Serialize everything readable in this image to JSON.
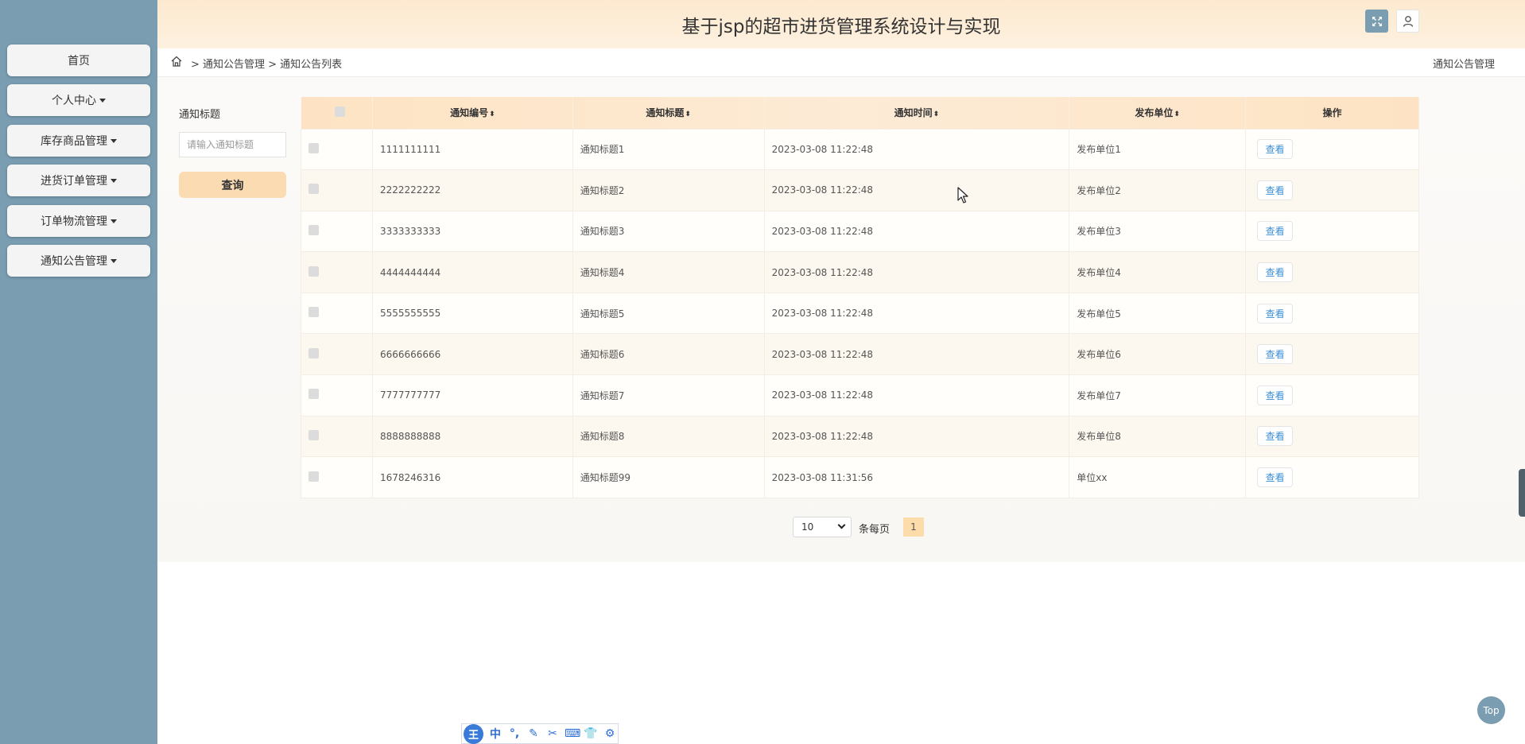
{
  "sidebar": {
    "items": [
      {
        "label": "首页",
        "dropdown": false
      },
      {
        "label": "个人中心",
        "dropdown": true
      },
      {
        "label": "库存商品管理",
        "dropdown": true
      },
      {
        "label": "进货订单管理",
        "dropdown": true
      },
      {
        "label": "订单物流管理",
        "dropdown": true
      },
      {
        "label": "通知公告管理",
        "dropdown": true
      }
    ]
  },
  "header": {
    "title": "基于jsp的超市进货管理系统设计与实现",
    "expand_icon": "fullscreen-icon",
    "user_icon": "user-icon"
  },
  "breadcrumb": {
    "home_icon": "home-icon",
    "path": "> 通知公告管理 > 通知公告列表",
    "current": "通知公告管理"
  },
  "search": {
    "label": "通知标题",
    "placeholder": "请输入通知标题",
    "button": "查询"
  },
  "table": {
    "columns": [
      "通知编号",
      "通知标题",
      "通知时间",
      "发布单位",
      "操作"
    ],
    "sort_marker": "⬍",
    "action_label": "查看",
    "rows": [
      {
        "id": "1111111111",
        "title": "通知标题1",
        "time": "2023-03-08 11:22:48",
        "unit": "发布单位1"
      },
      {
        "id": "2222222222",
        "title": "通知标题2",
        "time": "2023-03-08 11:22:48",
        "unit": "发布单位2"
      },
      {
        "id": "3333333333",
        "title": "通知标题3",
        "time": "2023-03-08 11:22:48",
        "unit": "发布单位3"
      },
      {
        "id": "4444444444",
        "title": "通知标题4",
        "time": "2023-03-08 11:22:48",
        "unit": "发布单位4"
      },
      {
        "id": "5555555555",
        "title": "通知标题5",
        "time": "2023-03-08 11:22:48",
        "unit": "发布单位5"
      },
      {
        "id": "6666666666",
        "title": "通知标题6",
        "time": "2023-03-08 11:22:48",
        "unit": "发布单位6"
      },
      {
        "id": "7777777777",
        "title": "通知标题7",
        "time": "2023-03-08 11:22:48",
        "unit": "发布单位7"
      },
      {
        "id": "8888888888",
        "title": "通知标题8",
        "time": "2023-03-08 11:22:48",
        "unit": "发布单位8"
      },
      {
        "id": "1678246316",
        "title": "通知标题99",
        "time": "2023-03-08 11:31:56",
        "unit": "单位xx"
      }
    ]
  },
  "pagination": {
    "page_size": "10",
    "per_page_label": "条每页",
    "current_page": "1"
  },
  "top_button": "Top",
  "ime_toolbar": {
    "logo": "王",
    "items": [
      "中",
      "°,",
      "✎",
      "✂",
      "⌨",
      "👕",
      "⚙"
    ]
  },
  "colors": {
    "sidebar": "#7a9db2",
    "header": "#fde9cf",
    "accent": "#fbdcb2",
    "link": "#3a8ed6"
  }
}
